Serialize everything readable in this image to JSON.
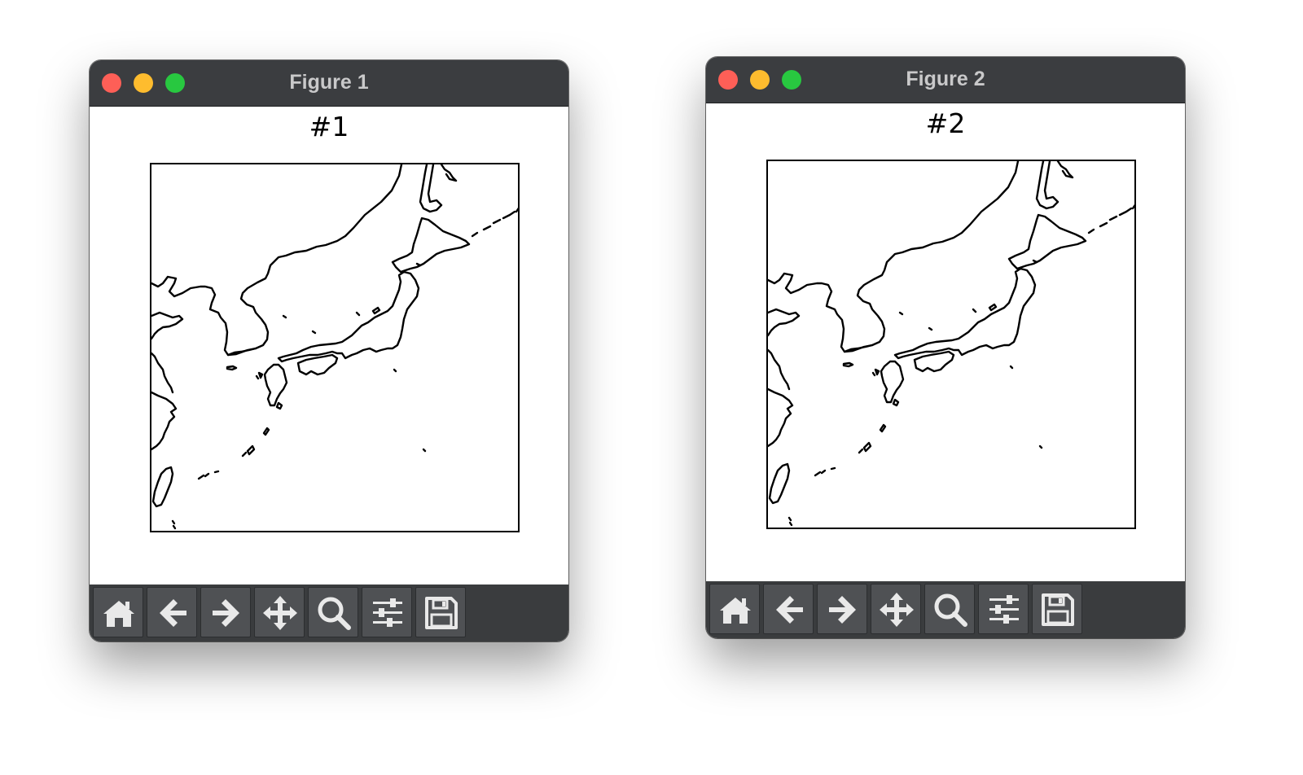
{
  "windows": [
    {
      "title": "Figure 1",
      "plot_title": "#1",
      "toolbar": [
        "home-icon",
        "back-icon",
        "forward-icon",
        "pan-icon",
        "zoom-icon",
        "configure-icon",
        "save-icon"
      ]
    },
    {
      "title": "Figure 2",
      "plot_title": "#2",
      "toolbar": [
        "home-icon",
        "back-icon",
        "forward-icon",
        "pan-icon",
        "zoom-icon",
        "configure-icon",
        "save-icon"
      ]
    }
  ],
  "colors": {
    "titlebar": "#3b3d40",
    "title_text": "#c9c9ca",
    "toolbar": "#3a3c3e",
    "toolbar_button": "#4f5154",
    "icon": "#e9e9e9",
    "close": "#fe5f57",
    "minimize": "#febc2e",
    "zoom": "#28c840"
  }
}
